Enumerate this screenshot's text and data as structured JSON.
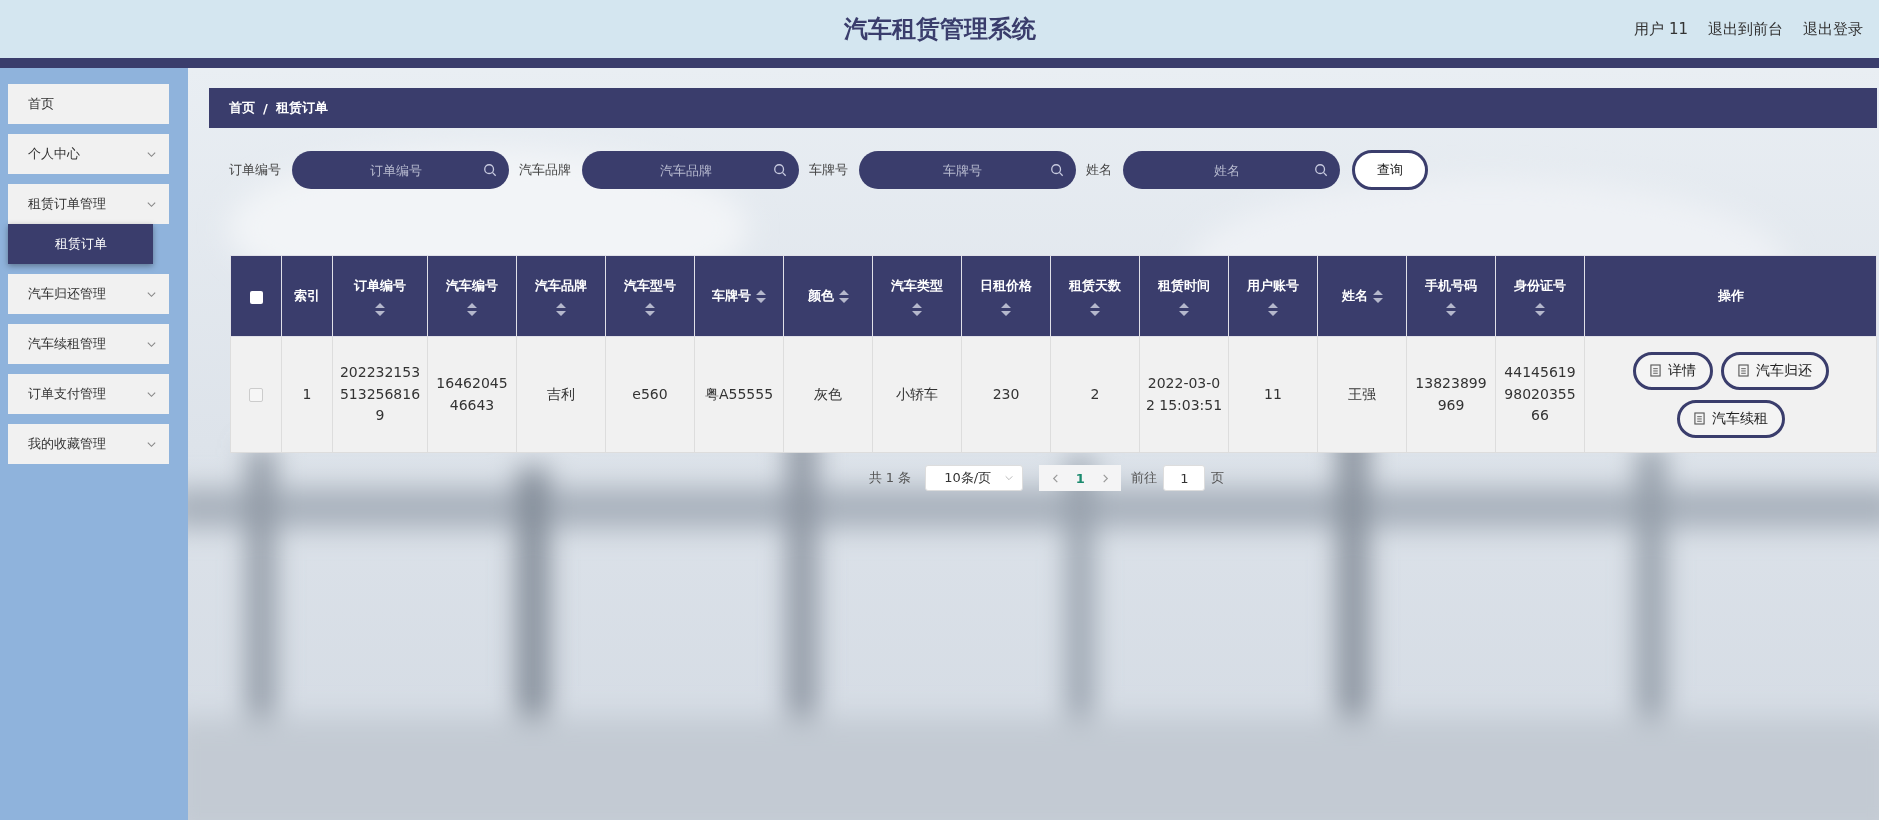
{
  "header": {
    "title": "汽车租赁管理系统",
    "user": "用户 11",
    "links": [
      "退出到前台",
      "退出登录"
    ]
  },
  "sidebar": {
    "items": [
      {
        "label": "首页",
        "expandable": false
      },
      {
        "label": "个人中心",
        "expandable": true
      },
      {
        "label": "租赁订单管理",
        "expandable": true,
        "expanded": true,
        "children": [
          {
            "label": "租赁订单",
            "selected": true
          }
        ]
      },
      {
        "label": "汽车归还管理",
        "expandable": true
      },
      {
        "label": "汽车续租管理",
        "expandable": true
      },
      {
        "label": "订单支付管理",
        "expandable": true
      },
      {
        "label": "我的收藏管理",
        "expandable": true
      }
    ]
  },
  "breadcrumb": {
    "items": [
      "首页",
      "租赁订单"
    ],
    "separator": "/"
  },
  "search": {
    "fields": [
      {
        "label": "订单编号",
        "placeholder": "订单编号"
      },
      {
        "label": "汽车品牌",
        "placeholder": "汽车品牌"
      },
      {
        "label": "车牌号",
        "placeholder": "车牌号"
      },
      {
        "label": "姓名",
        "placeholder": "姓名"
      }
    ],
    "button": "查询"
  },
  "table": {
    "select_all": {
      "checked": false
    },
    "columns": [
      {
        "kind": "text",
        "label": "索引",
        "sortable": false
      },
      {
        "kind": "text",
        "label": "订单编号",
        "sortable": true
      },
      {
        "kind": "text",
        "label": "汽车编号",
        "sortable": true
      },
      {
        "kind": "text",
        "label": "汽车品牌",
        "sortable": true
      },
      {
        "kind": "text",
        "label": "汽车型号",
        "sortable": true
      },
      {
        "kind": "text",
        "label": "车牌号",
        "sortable": true
      },
      {
        "kind": "text",
        "label": "颜色",
        "sortable": true
      },
      {
        "kind": "text",
        "label": "汽车类型",
        "sortable": true
      },
      {
        "kind": "text",
        "label": "日租价格",
        "sortable": true
      },
      {
        "kind": "text",
        "label": "租赁天数",
        "sortable": true
      },
      {
        "kind": "text",
        "label": "租赁时间",
        "sortable": true
      },
      {
        "kind": "text",
        "label": "用户账号",
        "sortable": true
      },
      {
        "kind": "text",
        "label": "姓名",
        "sortable": true
      },
      {
        "kind": "text",
        "label": "手机号码",
        "sortable": true
      },
      {
        "kind": "text",
        "label": "身份证号",
        "sortable": true
      },
      {
        "kind": "actions",
        "label": "操作",
        "sortable": false
      }
    ],
    "rows": [
      {
        "checked": false,
        "cells": [
          "1",
          "2022321535132568169",
          "1646204546643",
          "吉利",
          "e560",
          "粤A55555",
          "灰色",
          "小轿车",
          "230",
          "2",
          "2022-03-02 15:03:51",
          "11",
          "王强",
          "13823899969",
          "441456199802035566"
        ],
        "actions": [
          "详情",
          "汽车归还",
          "汽车续租"
        ]
      }
    ]
  },
  "pagination": {
    "total": "共 1 条",
    "page_size": "10条/页",
    "pages": [
      {
        "label": "1",
        "selected": true
      }
    ],
    "jump_label": "前往",
    "jump_value": "1",
    "jump_suffix": "页"
  }
}
